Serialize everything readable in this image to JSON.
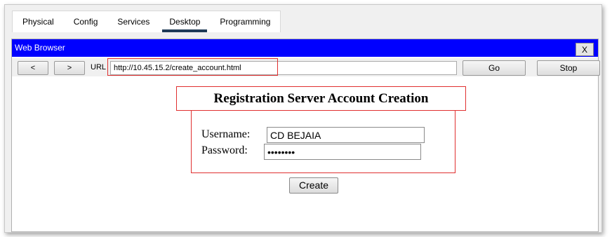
{
  "tabs": [
    {
      "label": "Physical"
    },
    {
      "label": "Config"
    },
    {
      "label": "Services"
    },
    {
      "label": "Desktop",
      "active": true
    },
    {
      "label": "Programming"
    }
  ],
  "browser": {
    "title": "Web Browser",
    "close_label": "X",
    "back_label": "<",
    "forward_label": ">",
    "url_label": "URL",
    "url_value": "http://10.45.15.2/create_account.html",
    "go_label": "Go",
    "stop_label": "Stop"
  },
  "page": {
    "title": "Registration Server Account Creation",
    "username_label": "Username:",
    "username_value": "CD BEJAIA",
    "password_label": "Password:",
    "password_value": "••••••••",
    "create_label": "Create"
  },
  "colors": {
    "titlebar": "#0000ff",
    "highlight": "#e03030",
    "active_tab_underline": "#1f3b57"
  }
}
